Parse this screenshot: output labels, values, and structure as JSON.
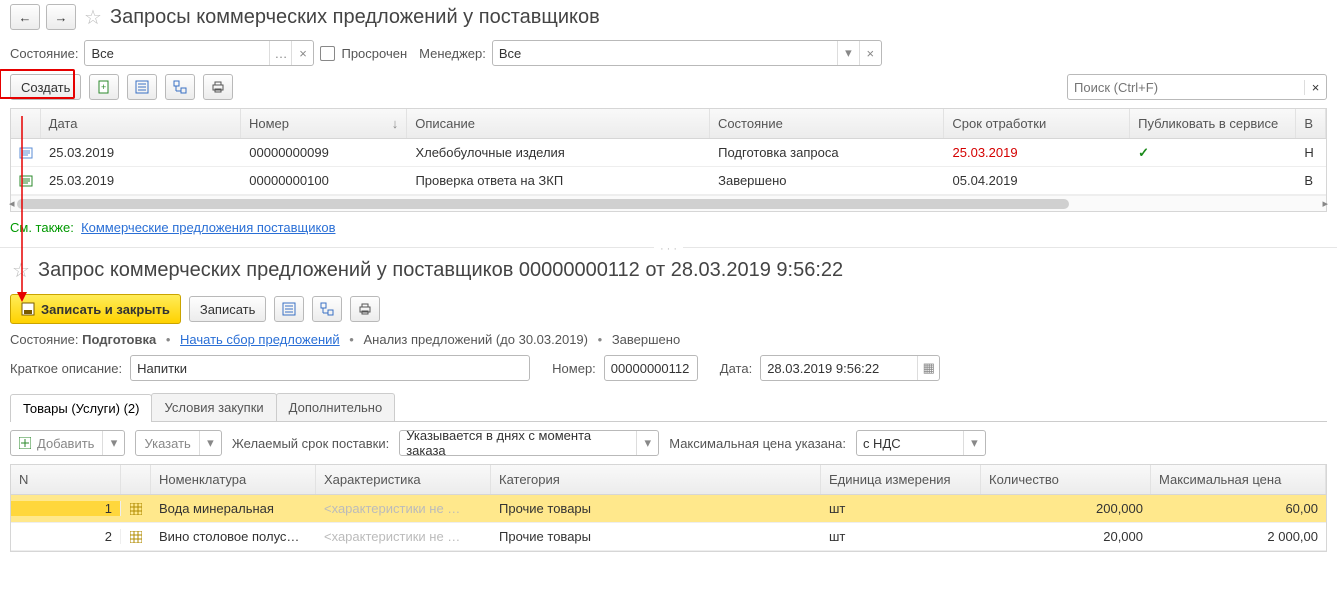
{
  "nav": {
    "back": "←",
    "forward": "→"
  },
  "list": {
    "title": "Запросы коммерческих предложений у поставщиков",
    "filter": {
      "state_label": "Состояние:",
      "state_value": "Все",
      "overdue_label": "Просрочен",
      "manager_label": "Менеджер:",
      "manager_value": "Все"
    },
    "toolbar": {
      "create": "Создать"
    },
    "search_placeholder": "Поиск (Ctrl+F)",
    "columns": {
      "date": "Дата",
      "number": "Номер",
      "descr": "Описание",
      "state": "Состояние",
      "deadline": "Срок отработки",
      "publish": "Публиковать в сервисе",
      "last": "В"
    },
    "rows": [
      {
        "date": "25.03.2019",
        "number": "00000000099",
        "descr": "Хлебобулочные изделия",
        "state": "Подготовка запроса",
        "deadline": "25.03.2019",
        "deadline_red": true,
        "publish": "✓",
        "last": "Н"
      },
      {
        "date": "25.03.2019",
        "number": "00000000100",
        "descr": "Проверка ответа на ЗКП",
        "state": "Завершено",
        "deadline": "05.04.2019",
        "deadline_red": false,
        "publish": "",
        "last": "В"
      }
    ],
    "seealso_label": "См. также:",
    "seealso_link": "Коммерческие предложения поставщиков"
  },
  "detail": {
    "title": "Запрос коммерческих предложений у поставщиков 00000000112 от 28.03.2019 9:56:22",
    "toolbar": {
      "save_close": "Записать и закрыть",
      "save": "Записать"
    },
    "status": {
      "label": "Состояние:",
      "prep": "Подготовка",
      "start": "Начать сбор предложений",
      "analysis": "Анализ предложений (до 30.03.2019)",
      "done": "Завершено"
    },
    "fields": {
      "descr_label": "Краткое описание:",
      "descr_value": "Напитки",
      "number_label": "Номер:",
      "number_value": "00000000112",
      "date_label": "Дата:",
      "date_value": "28.03.2019  9:56:22"
    },
    "tabs": {
      "goods": "Товары (Услуги) (2)",
      "terms": "Условия закупки",
      "extra": "Дополнительно"
    },
    "subbar": {
      "add": "Добавить",
      "specify": "Указать",
      "shipdate_label": "Желаемый срок поставки:",
      "shipdate_value": "Указывается в днях с момента заказа",
      "price_label": "Максимальная цена указана:",
      "price_value": "с НДС"
    },
    "grid": {
      "cols": {
        "n": "N",
        "nomen": "Номенклатура",
        "char": "Характеристика",
        "cat": "Категория",
        "unit": "Единица измерения",
        "qty": "Количество",
        "price": "Максимальная цена"
      },
      "char_placeholder": "<характеристики не …",
      "rows": [
        {
          "n": "1",
          "nomen": "Вода минеральная",
          "cat": "Прочие товары",
          "unit": "шт",
          "qty": "200,000",
          "price": "60,00",
          "sel": true
        },
        {
          "n": "2",
          "nomen": "Вино столовое полус…",
          "cat": "Прочие товары",
          "unit": "шт",
          "qty": "20,000",
          "price": "2 000,00",
          "sel": false
        }
      ]
    }
  }
}
